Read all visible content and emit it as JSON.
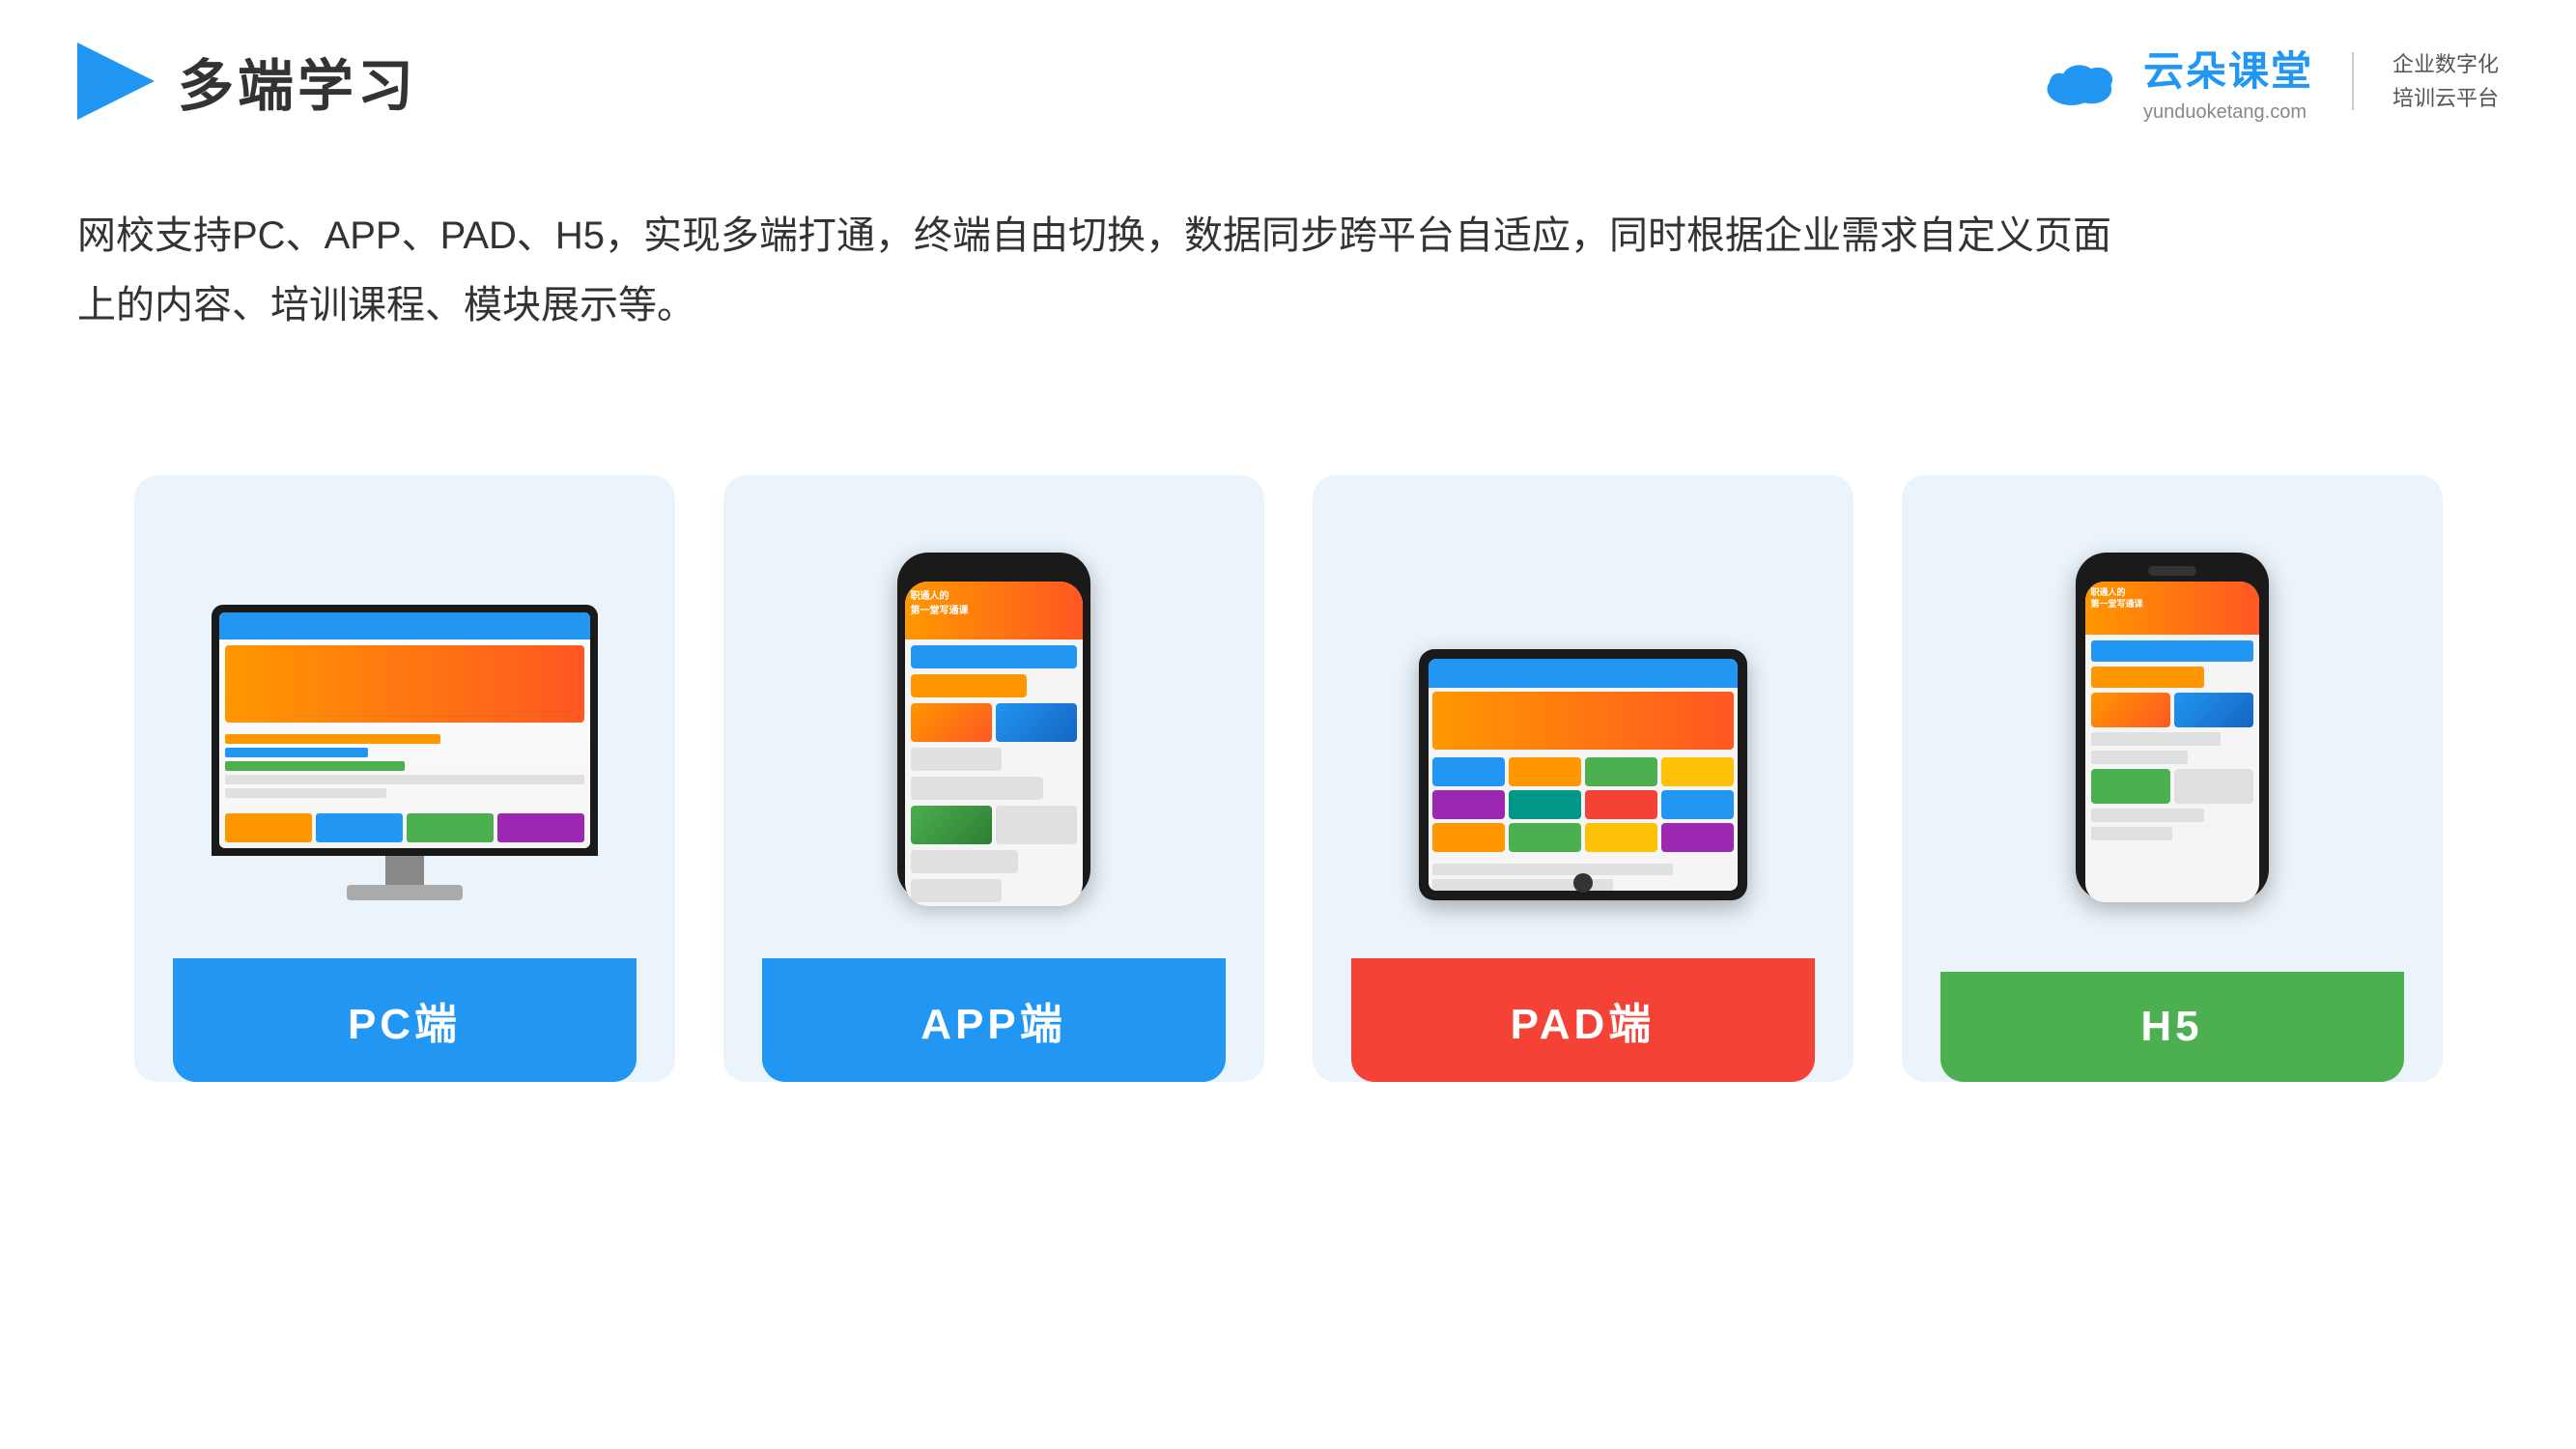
{
  "header": {
    "title": "多端学习",
    "logo_brand": "云朵课堂",
    "logo_url": "yunduoketang.com",
    "logo_slogan_line1": "企业数字化",
    "logo_slogan_line2": "培训云平台"
  },
  "description": {
    "text_line1": "网校支持PC、APP、PAD、H5，实现多端打通，终端自由切换，数据同步跨平台自适应，同时根据企业需求自定义页面",
    "text_line2": "上的内容、培训课程、模块展示等。"
  },
  "cards": [
    {
      "id": "pc",
      "label": "PC端",
      "color": "blue",
      "device": "monitor"
    },
    {
      "id": "app",
      "label": "APP端",
      "color": "blue",
      "device": "phone"
    },
    {
      "id": "pad",
      "label": "PAD端",
      "color": "red",
      "device": "tablet"
    },
    {
      "id": "h5",
      "label": "H5",
      "color": "green",
      "device": "phone"
    }
  ]
}
